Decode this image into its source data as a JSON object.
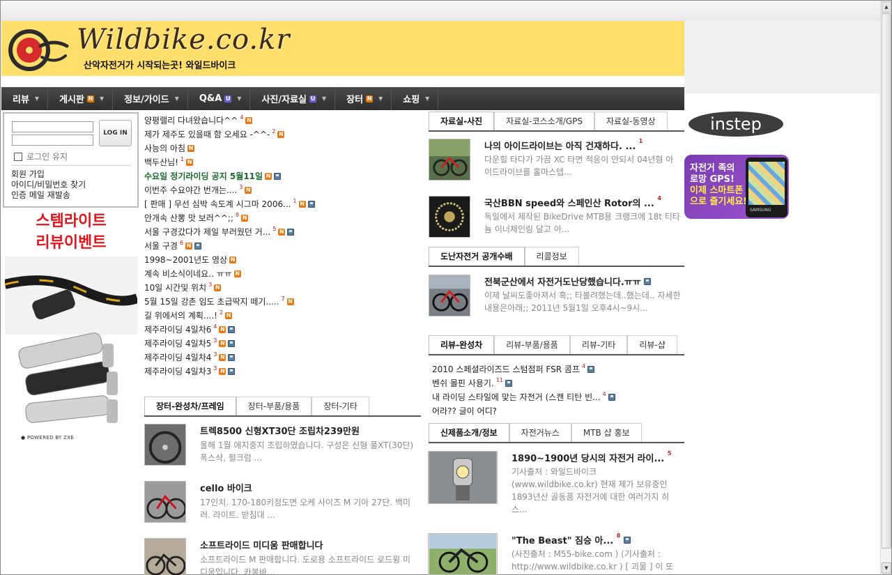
{
  "site": {
    "logo_text": "Wildbike.co.kr",
    "tagline": "산악자전거가 시작되는곳! 와일드바이크"
  },
  "nav": [
    {
      "label": "리뷰",
      "badge": ""
    },
    {
      "label": "게시판",
      "badge": "N"
    },
    {
      "label": "정보/가이드",
      "badge": ""
    },
    {
      "label": "Q&A",
      "badge": "U"
    },
    {
      "label": "사진/자료실",
      "badge": "U"
    },
    {
      "label": "장터",
      "badge": "N"
    },
    {
      "label": "쇼핑",
      "badge": ""
    }
  ],
  "login": {
    "button": "LOG IN",
    "keep_label": "로그인 유지",
    "links": [
      "회원 가입",
      "아이디/비밀번호 찾기",
      "인증 메일 재발송"
    ]
  },
  "promo": {
    "line1": "스템라이트",
    "line2": "리뷰이벤트",
    "powered": "POWERED BY ZXE"
  },
  "recent_posts": [
    {
      "title": "양평랠리 다녀왔습니다^^",
      "count": "4",
      "new": true,
      "file": false,
      "highlight": false
    },
    {
      "title": "제가 제주도 있을때 함 오세요 -^^-",
      "count": "2",
      "new": true,
      "file": false,
      "highlight": false
    },
    {
      "title": "사능의 아침",
      "count": "",
      "new": true,
      "file": false,
      "highlight": false
    },
    {
      "title": "백두산님!",
      "count": "1",
      "new": true,
      "file": false,
      "highlight": false
    },
    {
      "title": "수요일 정기라이딩 공지 5월11일",
      "count": "",
      "new": true,
      "file": true,
      "highlight": true
    },
    {
      "title": "이번주 수요야간 번개는....",
      "count": "3",
      "new": true,
      "file": false,
      "highlight": false
    },
    {
      "title": "[ 판매 ] 무선 심박 속도계 시그마 2006...",
      "count": "1",
      "new": true,
      "file": true,
      "highlight": false
    },
    {
      "title": "안개속 산뽕 맛 보러^^;;",
      "count": "8",
      "new": true,
      "file": false,
      "highlight": false
    },
    {
      "title": "서울 구경갔다가 제일 부러웠던 거...",
      "count": "5",
      "new": true,
      "file": true,
      "highlight": false
    },
    {
      "title": "서울 구경",
      "count": "6",
      "new": true,
      "file": true,
      "highlight": false
    },
    {
      "title": "1998~2001년도 영상",
      "count": "",
      "new": true,
      "file": false,
      "highlight": false
    },
    {
      "title": "계속 비소식이네요.. ㅠㅠ",
      "count": "",
      "new": true,
      "file": false,
      "highlight": false
    },
    {
      "title": "10일 시간및 위치",
      "count": "3",
      "new": true,
      "file": false,
      "highlight": false
    },
    {
      "title": "5월 15일 강촌 임도 초급딱지 떼기.....",
      "count": "7",
      "new": true,
      "file": false,
      "highlight": false
    },
    {
      "title": "길 위에서의 계획....!",
      "count": "2",
      "new": true,
      "file": false,
      "highlight": false
    },
    {
      "title": "제주라이딩 4일차6",
      "count": "4",
      "new": true,
      "file": true,
      "highlight": false
    },
    {
      "title": "제주라이딩 4일차5",
      "count": "3",
      "new": true,
      "file": true,
      "highlight": false
    },
    {
      "title": "제주라이딩 4일차4",
      "count": "3",
      "new": true,
      "file": true,
      "highlight": false
    },
    {
      "title": "제주라이딩 4일차3",
      "count": "3",
      "new": true,
      "file": true,
      "highlight": false
    }
  ],
  "market": {
    "tabs": [
      "장터-완성차/프레임",
      "장터-부품/용품",
      "장터-기타"
    ],
    "items": [
      {
        "title": "트렉8500 신형XT30단 조립차239만원",
        "desc": "올해 1월 애지중지 조립하였습니다. 구성은 신형 풀XT(30단) 폭스샥, 펄크럼 ..."
      },
      {
        "title": "cello 바이크",
        "desc": "17인치. 170-180키정도면 오케 사이즈 M 기아 27단. 백미러. 라이트. 받침대 ..."
      },
      {
        "title": "소프트라이드 미디움 판매합니다",
        "desc": "소프트라이드 M 판매합니다. 도로용 소프트라이드 로드윙 미디움입니다. 카봉바..."
      }
    ]
  },
  "photos": {
    "tabs": [
      "자료실-사진",
      "자료실-코스소개/GPS",
      "자료실-동영상"
    ],
    "items": [
      {
        "title": "나의 아이드라이브는 아직 건재하다. ...",
        "count": "1",
        "desc": "다운힐 타다가 가끔 XC 타면 적응이 안되서 04년형 아이드라이브를 홀마스텝..."
      },
      {
        "title": "국산BBN speed와 스페인산 Rotor의 ...",
        "count": "4",
        "desc": "독일에서 제작된 BikeDrive MTB용 크랭크에 18t 티타늄 이너체인링 달고 아..."
      }
    ]
  },
  "theft": {
    "tabs": [
      "도난자전거 공개수배",
      "리콜정보"
    ],
    "item": {
      "title": "전북군산에서 자전거도난당했습니다.ㅠㅠ",
      "desc": "이제 날씨도좋아져서 흑;; 타볼려했는데..했는데.. 자세한내용은아래;; 2011년 5월1일 오후4시~9시..."
    }
  },
  "reviews": {
    "tabs": [
      "리뷰-완성차",
      "리뷰-부품/용품",
      "리뷰-기타",
      "리뷰-샵"
    ],
    "items": [
      {
        "title": "2010 스페셜라이즈드 스텀점퍼 FSR 콤프",
        "count": "4",
        "file": true
      },
      {
        "title": "벤쉬 몰핀 사용기.",
        "count": "11",
        "file": true
      },
      {
        "title": "내 라이딩 스타일에 맞는 자전거 (스캔 티탄 빈...",
        "count": "4",
        "file": true
      },
      {
        "title": "어라?? 글이 어디?",
        "count": "",
        "file": false
      }
    ]
  },
  "news": {
    "tabs": [
      "신제품소개/정보",
      "자전거뉴스",
      "MTB 샵 홍보"
    ],
    "items": [
      {
        "title": "1890~1900년 당시의 자전거 라이...",
        "count": "5",
        "desc": "기사출처 : 와일드바이크 (www.wildbike.co.kr) 현재 제가 보유중인 1893년산 골동품 자전거에 대한 여러가지 히스..."
      },
      {
        "title": "\"The Beast\" 짐승 아...",
        "count": "8",
        "desc": "(사진출처 : M55-bike.com ) (기사출처 : http://www.wildbike.co.kr ) [ 괴물 ] 이 또"
      }
    ]
  },
  "ads": {
    "instep": "instep",
    "gps_line1": "자전거 족의",
    "gps_line2": "로망 GPS!",
    "gps_line3": "이제 스마트폰",
    "gps_line4": "으로 즐기세요!",
    "phone_brand": "SAMSUNG"
  },
  "colors": {
    "header_bg": "#ffdf6b",
    "nav_bg": "#3a3a3a",
    "new_badge": "#e8770e",
    "update_badge": "#6b5fd6",
    "promo_red": "#e0151a",
    "highlight_green": "#1c6a2c"
  }
}
